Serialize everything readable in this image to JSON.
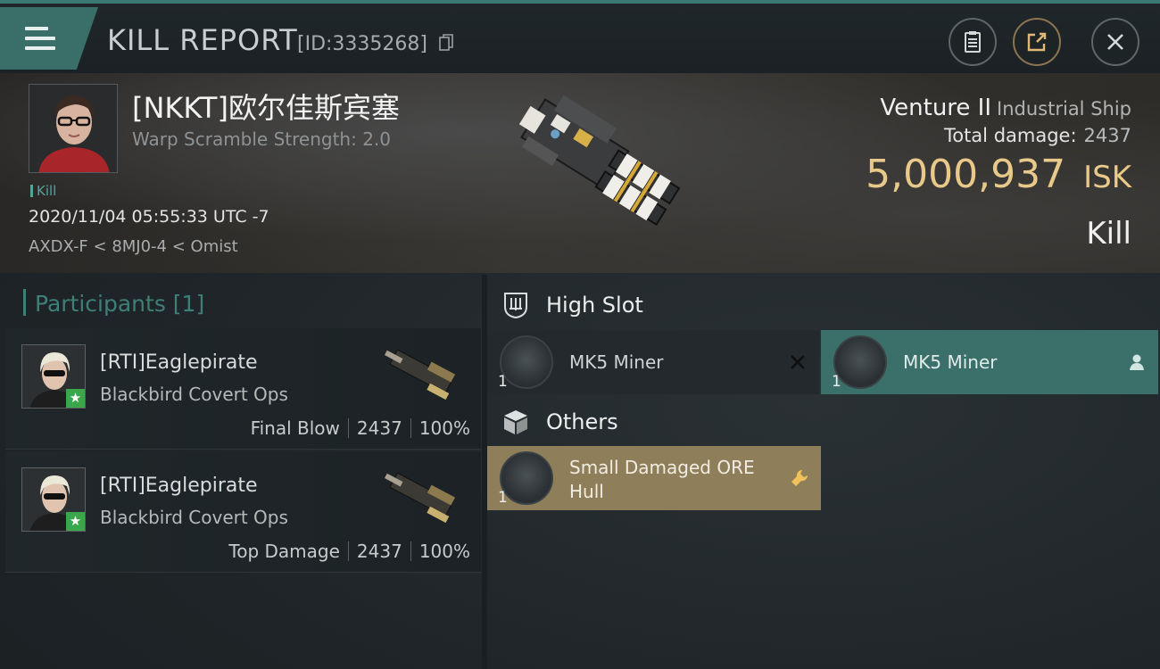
{
  "header": {
    "title": "KILL REPORT",
    "report_id": "[ID:3335268]",
    "menu_icon": "hamburger-menu-icon",
    "buttons": [
      "clipboard-icon",
      "share-icon",
      "close-icon"
    ]
  },
  "victim": {
    "name": "[NKKT]欧尔佳斯宾塞",
    "warp_scramble": "Warp Scramble Strength: 2.0",
    "tag": "Kill",
    "datetime": "2020/11/04 05:55:33 UTC -7",
    "location": "AXDX-F < 8MJ0-4 < Omist",
    "ship_name": "Venture II",
    "ship_class": "Industrial Ship",
    "total_damage_label": "Total damage:",
    "total_damage_value": "2437",
    "isk_value": "5,000,937",
    "isk_unit": "ISK",
    "result": "Kill"
  },
  "participants": {
    "label": "Participants [1]",
    "items": [
      {
        "name": "[RTI]Eaglepirate",
        "ship": "Blackbird Covert Ops",
        "role": "Final Blow",
        "damage": "2437",
        "percent": "100%"
      },
      {
        "name": "[RTI]Eaglepirate",
        "ship": "Blackbird Covert Ops",
        "role": "Top Damage",
        "damage": "2437",
        "percent": "100%"
      }
    ]
  },
  "slots": {
    "high": {
      "label": "High Slot",
      "modules": [
        {
          "name": "MK5 Miner",
          "qty": "1",
          "status": "destroyed"
        },
        {
          "name": "MK5 Miner",
          "qty": "1",
          "status": "dropped"
        }
      ]
    },
    "others": {
      "label": "Others",
      "modules": [
        {
          "name_line1": "Small Damaged ORE",
          "name_line2": "Hull",
          "qty": "1",
          "status": "salvage"
        }
      ]
    }
  },
  "colors": {
    "accent_teal": "#3b6f69",
    "isk_gold": "#e9c98a",
    "salvage_gold": "#8f7e5a"
  }
}
